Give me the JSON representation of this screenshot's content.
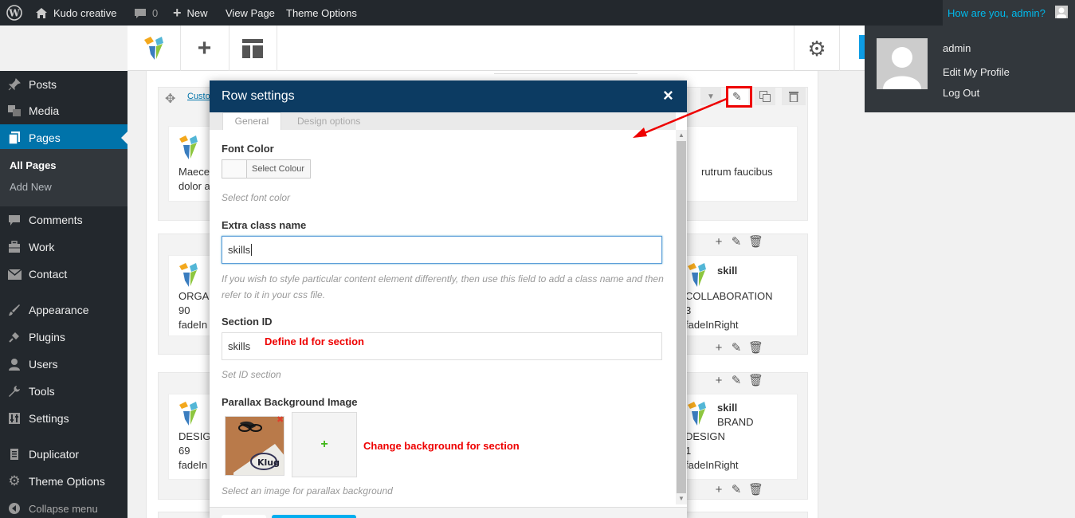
{
  "adminbar": {
    "site_name": "Kudo creative",
    "comments_count": "0",
    "new_label": "New",
    "view_page": "View Page",
    "theme_options": "Theme Options",
    "greeting": "How are you, admin?"
  },
  "user_dropdown": {
    "username": "admin",
    "edit_profile": "Edit My Profile",
    "logout": "Log Out"
  },
  "sidebar": {
    "items": [
      {
        "label": "Posts",
        "icon": "pin-icon"
      },
      {
        "label": "Media",
        "icon": "media-icon"
      },
      {
        "label": "Pages",
        "icon": "pages-icon",
        "current": true
      },
      {
        "label": "Comments",
        "icon": "comment-icon"
      },
      {
        "label": "Work",
        "icon": "portfolio-icon"
      },
      {
        "label": "Contact",
        "icon": "mail-icon"
      },
      {
        "label": "Appearance",
        "icon": "brush-icon"
      },
      {
        "label": "Plugins",
        "icon": "plug-icon"
      },
      {
        "label": "Users",
        "icon": "user-icon"
      },
      {
        "label": "Tools",
        "icon": "wrench-icon"
      },
      {
        "label": "Settings",
        "icon": "settings-icon"
      },
      {
        "label": "Duplicator",
        "icon": "copy-icon"
      },
      {
        "label": "Theme Options",
        "icon": "gear-icon"
      },
      {
        "label": "Collapse menu",
        "icon": "collapse-icon"
      }
    ],
    "submenu": [
      "All Pages",
      "Add New"
    ]
  },
  "background": {
    "row1_link": "Custo",
    "row1_left_text": [
      "Maece",
      "dolor a"
    ],
    "row1_right_text": "rutrum faucibus",
    "row2_left": [
      "ORGAN",
      "90",
      "fadeIn"
    ],
    "row2_right_title": "skill",
    "row2_right": [
      "COLLABORATION",
      "3",
      "fadeInRight"
    ],
    "row3_left": [
      "DESIGN",
      "69",
      "fadeIn"
    ],
    "row3_right_title": "skill",
    "row3_right": [
      "BRAND",
      "DESIGN",
      "1",
      "fadeInRight"
    ]
  },
  "modal": {
    "title": "Row settings",
    "close_glyph": "×",
    "tabs": [
      "General",
      "Design options"
    ],
    "font_color_label": "Font Color",
    "color_button": "Select Colour",
    "font_color_help": "Select font color",
    "extra_class_label": "Extra class name",
    "extra_class_value": "skills",
    "extra_class_help": "If you wish to style particular content element differently, then use this field to add a class name and then refer to it in your css file.",
    "section_id_label": "Section ID",
    "section_id_value": "skills",
    "section_id_help": "Set ID section",
    "parallax_label": "Parallax Background Image",
    "parallax_help": "Select an image for parallax background",
    "remove_glyph": "✖",
    "add_glyph": "+",
    "image_caption": "Klug"
  },
  "annotations": {
    "section_id_note": "Define Id for section",
    "background_note": "Change background for section"
  },
  "colors": {
    "admin_bar": "#23282d",
    "modal_header": "#0c3b62",
    "accent": "#0073aa",
    "annotation": "#e00000"
  }
}
